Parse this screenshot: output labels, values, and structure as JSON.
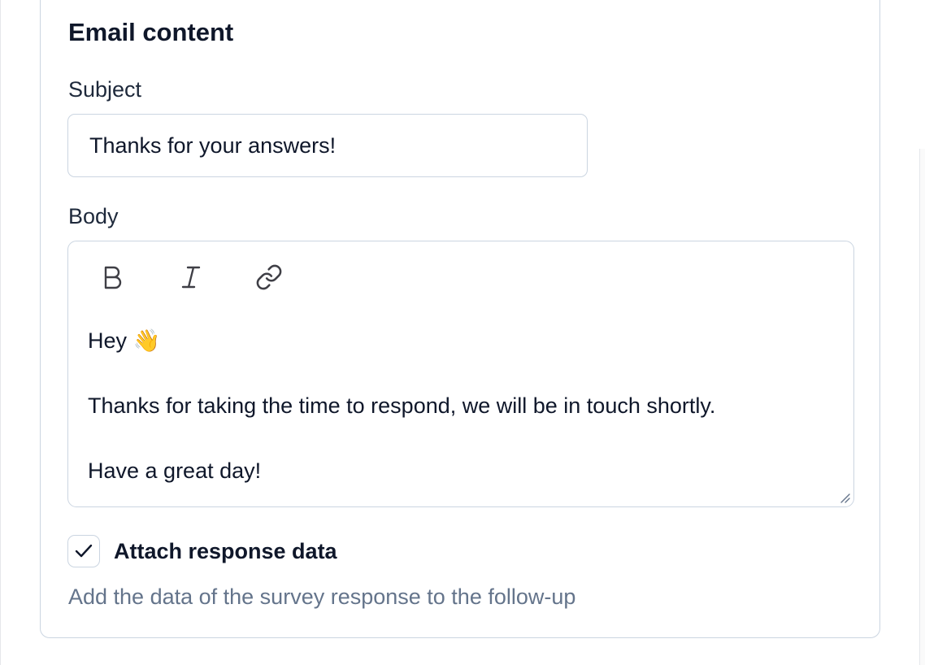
{
  "section": {
    "title": "Email content"
  },
  "subject": {
    "label": "Subject",
    "value": "Thanks for your answers!"
  },
  "body": {
    "label": "Body",
    "toolbar": {
      "bold_icon": "bold-icon",
      "italic_icon": "italic-icon",
      "link_icon": "link-icon"
    },
    "lines": [
      "Hey 👋",
      "",
      "Thanks for taking the time to respond, we will be in touch shortly.",
      "",
      "Have a great day!"
    ]
  },
  "attach": {
    "checked": true,
    "label": "Attach response data",
    "help": "Add the data of the survey response to the follow-up"
  },
  "colors": {
    "border": "#cbd5e1",
    "text": "#0f172a",
    "muted": "#64748b"
  }
}
